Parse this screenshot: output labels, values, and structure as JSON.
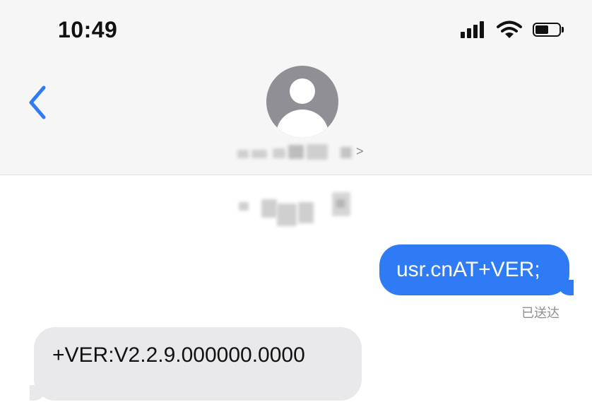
{
  "status_bar": {
    "time": "10:49",
    "icons": [
      "signal-icon",
      "wifi-icon",
      "battery-icon"
    ]
  },
  "header": {
    "back_icon": "chevron-left-icon",
    "avatar_icon": "person-icon",
    "contact_name_visible": false,
    "contact_chevron": ">"
  },
  "colors": {
    "accent": "#2f7bf5",
    "incoming_bubble": "#e9e9eb",
    "header_bg": "#f6f6f6"
  },
  "messages": [
    {
      "direction": "outgoing",
      "text": "usr.cnAT+VER;",
      "status": "已送达"
    },
    {
      "direction": "incoming",
      "text": "+VER:V2.2.9.000000.0000"
    }
  ]
}
